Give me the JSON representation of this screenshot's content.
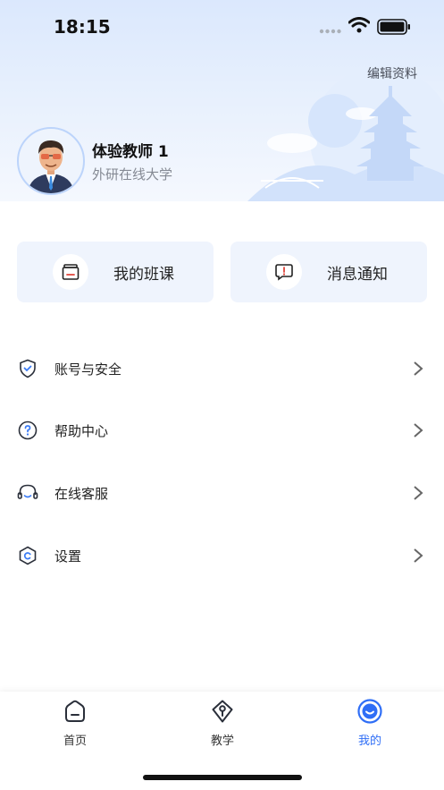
{
  "status_bar": {
    "time": "18:15"
  },
  "header": {
    "edit_label": "编辑资料"
  },
  "profile": {
    "name": "体验教师 1",
    "organization": "外研在线大学"
  },
  "quick_actions": [
    {
      "label": "我的班课",
      "icon": "class-icon"
    },
    {
      "label": "消息通知",
      "icon": "message-icon"
    }
  ],
  "menu": [
    {
      "label": "账号与安全",
      "icon": "shield-icon"
    },
    {
      "label": "帮助中心",
      "icon": "help-icon"
    },
    {
      "label": "在线客服",
      "icon": "headset-icon"
    },
    {
      "label": "设置",
      "icon": "settings-icon"
    }
  ],
  "tabbar": {
    "tabs": [
      {
        "label": "首页",
        "icon": "home-icon",
        "active": false
      },
      {
        "label": "教学",
        "icon": "teaching-icon",
        "active": false
      },
      {
        "label": "我的",
        "icon": "profile-icon",
        "active": true
      }
    ],
    "active_color": "#2f6ef6"
  },
  "colors": {
    "accent": "#2f6ef6",
    "card_bg": "#eff4fd",
    "hero_bg": "#dbe8fd"
  }
}
